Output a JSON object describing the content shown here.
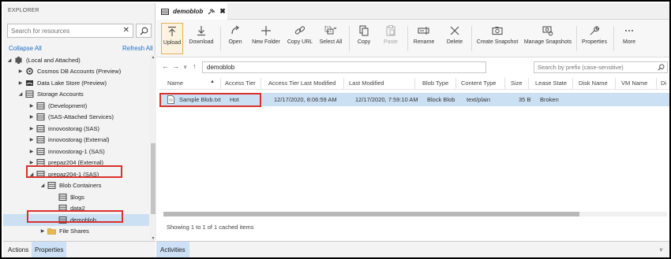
{
  "explorer": {
    "title": "EXPLORER",
    "search_placeholder": "Search for resources",
    "collapse_all": "Collapse All",
    "refresh_all": "Refresh All",
    "tree": [
      {
        "label": "(Local and Attached)",
        "icon": "plug-icon",
        "caret": "expanded"
      },
      {
        "label": "Cosmos DB Accounts (Preview)",
        "icon": "cosmos-db-icon",
        "caret": "collapsed"
      },
      {
        "label": "Data Lake Store (Preview)",
        "icon": "data-lake-icon",
        "caret": "collapsed"
      },
      {
        "label": "Storage Accounts",
        "icon": "storage-icon",
        "caret": "expanded"
      },
      {
        "label": "(Development)",
        "icon": "storage-account-icon",
        "caret": "collapsed"
      },
      {
        "label": "(SAS-Attached Services)",
        "icon": "storage-account-icon",
        "caret": "collapsed"
      },
      {
        "label": "innovostorag (SAS)",
        "icon": "storage-account-icon",
        "caret": "collapsed"
      },
      {
        "label": "innovostorag (External)",
        "icon": "storage-account-icon",
        "caret": "collapsed"
      },
      {
        "label": "innovostorag-1 (SAS)",
        "icon": "storage-account-icon",
        "caret": "collapsed"
      },
      {
        "label": "prepaz204 (External)",
        "icon": "storage-account-icon",
        "caret": "collapsed"
      },
      {
        "label": "prepaz204-1 (SAS)",
        "icon": "storage-account-icon",
        "caret": "expanded"
      },
      {
        "label": "Blob Containers",
        "icon": "blob-containers-icon",
        "caret": "expanded"
      },
      {
        "label": "$logs",
        "icon": "container-icon",
        "caret": "none"
      },
      {
        "label": "data2",
        "icon": "container-icon",
        "caret": "none"
      },
      {
        "label": "demoblob",
        "icon": "container-icon",
        "caret": "none"
      },
      {
        "label": "File Shares",
        "icon": "file-shares-icon",
        "caret": "collapsed"
      }
    ],
    "bottom_tabs": [
      "Actions",
      "Properties"
    ]
  },
  "document": {
    "tab_title": "demoblob"
  },
  "toolbar": {
    "buttons": [
      {
        "label": "Upload",
        "icon": "upload-icon"
      },
      {
        "label": "Download",
        "icon": "download-icon"
      },
      {
        "label": "Open",
        "icon": "open-icon"
      },
      {
        "label": "New Folder",
        "icon": "new-folder-icon"
      },
      {
        "label": "Copy URL",
        "icon": "link-icon"
      },
      {
        "label": "Select All",
        "icon": "select-all-icon"
      },
      {
        "label": "Copy",
        "icon": "copy-icon"
      },
      {
        "label": "Paste",
        "icon": "paste-icon"
      },
      {
        "label": "Rename",
        "icon": "rename-icon"
      },
      {
        "label": "Delete",
        "icon": "delete-icon"
      },
      {
        "label": "Create Snapshot",
        "icon": "camera-icon"
      },
      {
        "label": "Manage Snapshots",
        "icon": "manage-snapshots-icon"
      },
      {
        "label": "Properties",
        "icon": "wrench-icon"
      },
      {
        "label": "More",
        "icon": "more-icon"
      }
    ]
  },
  "navigation": {
    "path": "demoblob",
    "prefix_placeholder": "Search by prefix (case-sensitive)"
  },
  "table": {
    "columns": [
      "Name",
      "Access Tier",
      "Access Tier Last Modified",
      "Last Modified",
      "Blob Type",
      "Content Type",
      "Size",
      "Lease State",
      "Disk Name",
      "VM Name",
      "Di"
    ],
    "rows": [
      {
        "name": "Sample Blob.txt",
        "access_tier": "Hot",
        "access_tier_last_modified": "12/17/2020, 8:06:59 AM",
        "last_modified": "12/17/2020, 7:59:10 AM",
        "blob_type": "Block Blob",
        "content_type": "text/plain",
        "size": "35 B",
        "lease_state": "Broken"
      }
    ]
  },
  "status": "Showing 1 to 1 of 1 cached items",
  "activities": {
    "tab": "Activities"
  },
  "colors": {
    "accent": "#1f6fc5",
    "selection": "#cce0f4",
    "highlight_border": "#d9312e"
  }
}
